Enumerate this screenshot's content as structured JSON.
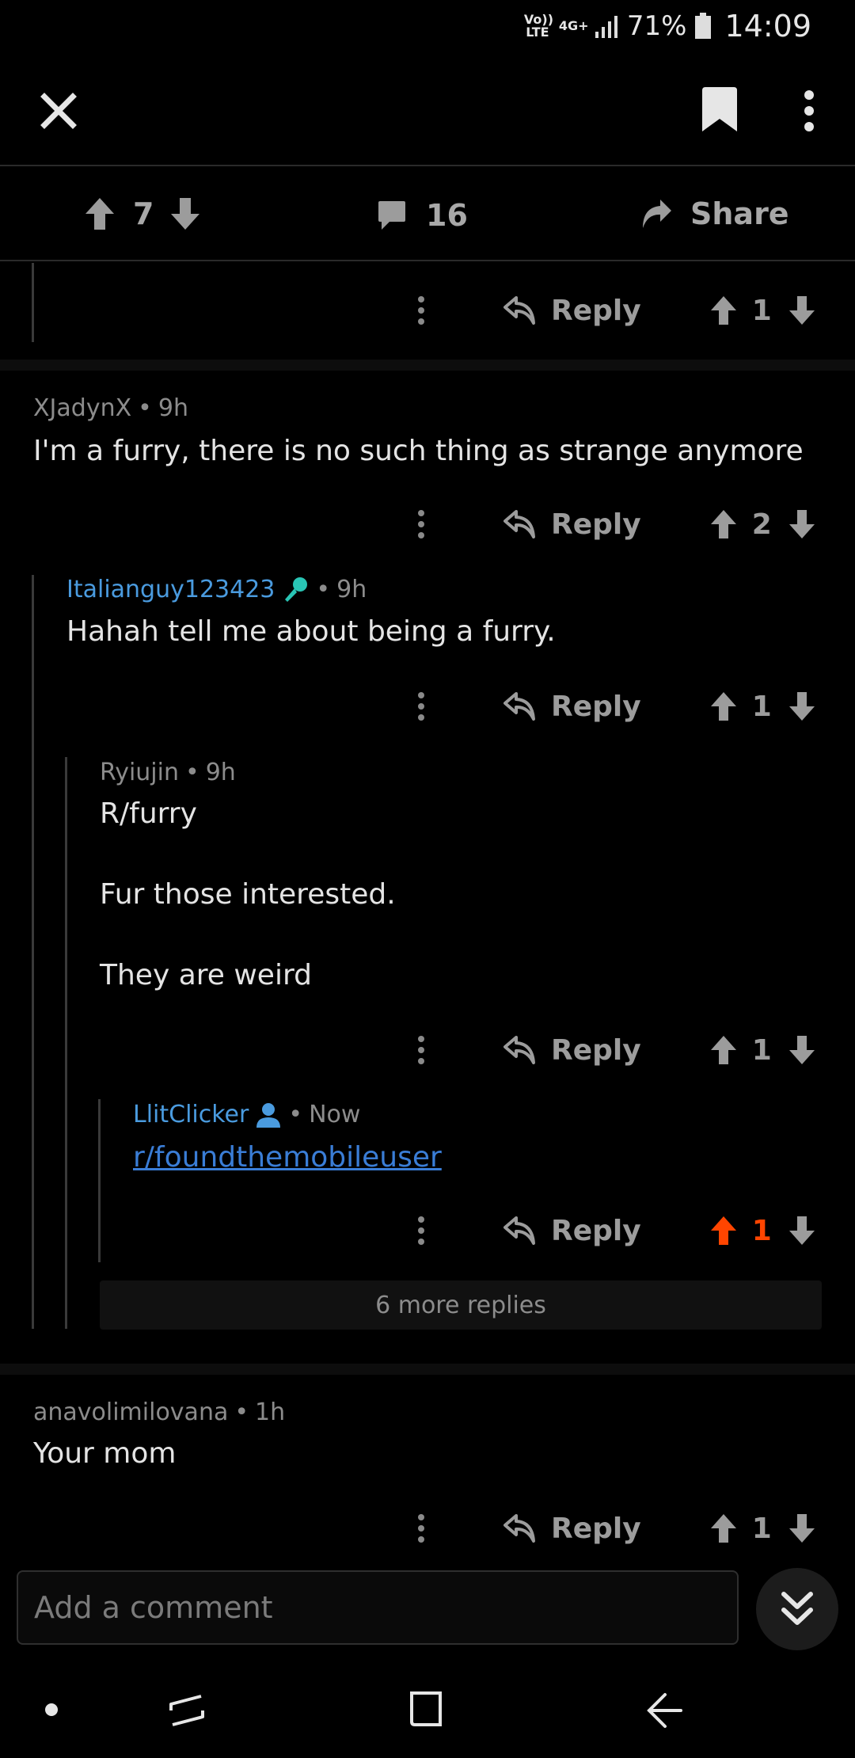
{
  "status_bar": {
    "volte": "Vo)) LTE",
    "network": "4G+",
    "battery_percent": "71%",
    "time": "14:09"
  },
  "post_bar": {
    "upvotes": "7",
    "comments": "16",
    "share_label": "Share"
  },
  "actions": {
    "reply_label": "Reply"
  },
  "comments": [
    {
      "score": "1"
    },
    {
      "author": "XJadynX",
      "age": "9h",
      "body": "I'm a furry, there is no such thing as strange anymore",
      "score": "2"
    },
    {
      "author": "Italianguy123423",
      "age": "9h",
      "body": "Hahah tell me about being a furry.",
      "score": "1"
    },
    {
      "author": "Ryiujin",
      "age": "9h",
      "body_lines": [
        "R/furry",
        "Fur those interested.",
        "They are weird"
      ],
      "score": "1"
    },
    {
      "author": "LlitClicker",
      "age": "Now",
      "link": "r/foundthemobileuser",
      "score": "1"
    },
    {
      "author": "anavolimilovana",
      "age": "1h",
      "body": "Your mom",
      "score": "1"
    }
  ],
  "more_replies": "6 more replies",
  "comment_input": {
    "placeholder": "Add a comment"
  },
  "colors": {
    "background": "#000000",
    "upvoted": "#ff4500",
    "username_blue": "#4a9bdf",
    "link": "#3a7dd6",
    "mic_icon": "#29c5b5"
  },
  "icons": [
    "close-icon",
    "bookmark-icon",
    "more-vertical-icon",
    "upvote-icon",
    "downvote-icon",
    "comment-icon",
    "share-arrow-icon",
    "reply-icon",
    "microphone-icon",
    "user-icon",
    "chevron-double-down-icon"
  ]
}
